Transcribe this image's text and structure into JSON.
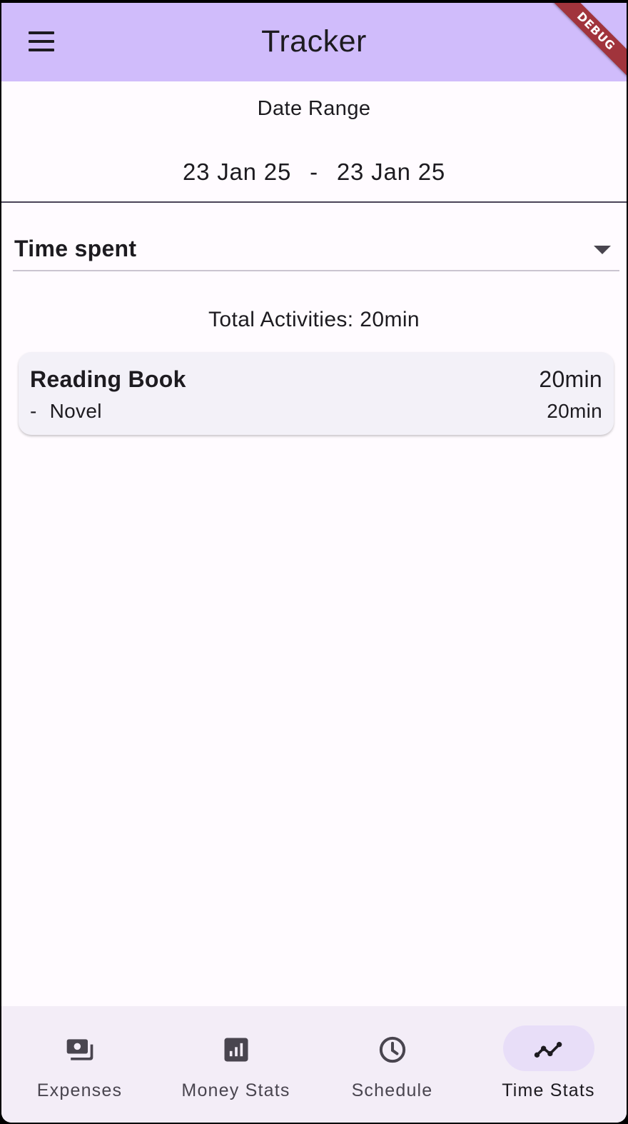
{
  "app": {
    "title": "Tracker",
    "debug_banner": "DEBUG"
  },
  "date_range": {
    "label": "Date Range",
    "start": "23 Jan 25",
    "separator": "-",
    "end": "23 Jan 25"
  },
  "filter": {
    "selected": "Time spent"
  },
  "summary": {
    "total_text": "Total Activities: 20min"
  },
  "activities": [
    {
      "name": "Reading Book",
      "total": "20min",
      "sub_dash": "-",
      "sub_name": "Novel",
      "sub_total": "20min"
    }
  ],
  "bottom_nav": {
    "items": [
      {
        "label": "Expenses",
        "icon": "payments-icon"
      },
      {
        "label": "Money Stats",
        "icon": "bar-chart-icon"
      },
      {
        "label": "Schedule",
        "icon": "clock-icon"
      },
      {
        "label": "Time Stats",
        "icon": "line-chart-icon",
        "active": true
      }
    ]
  },
  "colors": {
    "app_bar": "#d0bcfb",
    "background": "#fffbff",
    "card": "#f3f1f8",
    "nav_bar": "#f3edf7",
    "nav_active_pill": "#e8def8",
    "debug_banner": "#a1343c"
  }
}
